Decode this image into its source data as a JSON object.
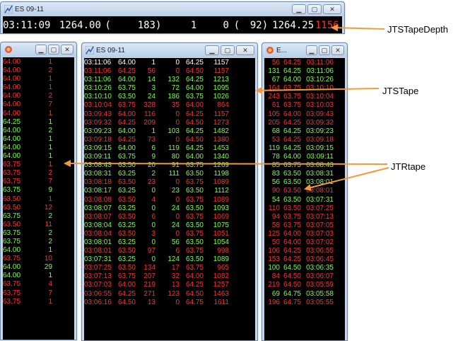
{
  "colors": {
    "up": "#80ff40",
    "down": "#ff3030",
    "neutral": "#ffffff",
    "background": "#000000",
    "arrow": "#f29a3a"
  },
  "depth_window": {
    "title": "ES 09-11",
    "time": "03:11:09",
    "price": "1264.00",
    "open_paren": "(",
    "bid_size": "183)",
    "ask_count": "1",
    "zero": "0",
    "open_paren2": "(",
    "ask_size": "92)",
    "last_price": "1264.25",
    "last_size": "1156"
  },
  "rtape_window": {
    "rows": [
      {
        "price": "64.00",
        "size": "1",
        "dir": "dn"
      },
      {
        "price": "64.00",
        "size": "2",
        "dir": "dn"
      },
      {
        "price": "64.00",
        "size": "1",
        "dir": "dn"
      },
      {
        "price": "64.00",
        "size": "1",
        "dir": "dn"
      },
      {
        "price": "64.00",
        "size": "2",
        "dir": "dn"
      },
      {
        "price": "64.00",
        "size": "7",
        "dir": "dn"
      },
      {
        "price": "64.00",
        "size": "1",
        "dir": "dn"
      },
      {
        "price": "64.25",
        "size": "1",
        "dir": "up"
      },
      {
        "price": "64.00",
        "size": "2",
        "dir": "up"
      },
      {
        "price": "64.00",
        "size": "1",
        "dir": "up"
      },
      {
        "price": "64.00",
        "size": "1",
        "dir": "up"
      },
      {
        "price": "64.00",
        "size": "1",
        "dir": "up"
      },
      {
        "price": "63.75",
        "size": "1",
        "dir": "dn"
      },
      {
        "price": "63.75",
        "size": "2",
        "dir": "dn"
      },
      {
        "price": "63.75",
        "size": "7",
        "dir": "dn"
      },
      {
        "price": "63.75",
        "size": "9",
        "dir": "up"
      },
      {
        "price": "63.50",
        "size": "1",
        "dir": "dn"
      },
      {
        "price": "63.50",
        "size": "12",
        "dir": "dn"
      },
      {
        "price": "63.75",
        "size": "2",
        "dir": "up"
      },
      {
        "price": "63.50",
        "size": "11",
        "dir": "dn"
      },
      {
        "price": "63.75",
        "size": "2",
        "dir": "up"
      },
      {
        "price": "63.75",
        "size": "2",
        "dir": "up"
      },
      {
        "price": "64.00",
        "size": "1",
        "dir": "up"
      },
      {
        "price": "63.75",
        "size": "10",
        "dir": "dn"
      },
      {
        "price": "64.00",
        "size": "29",
        "dir": "up"
      },
      {
        "price": "64.00",
        "size": "1",
        "dir": "up"
      },
      {
        "price": "63.75",
        "size": "4",
        "dir": "dn"
      },
      {
        "price": "63.75",
        "size": "7",
        "dir": "dn"
      },
      {
        "price": "63.75",
        "size": "1",
        "dir": "dn"
      }
    ]
  },
  "tape_window": {
    "title": "ES 09-11",
    "rows": [
      {
        "time": "03:11:06",
        "price": "64.00",
        "size": "1",
        "bid": "0",
        "ask": "64.25",
        "vol": "1157",
        "dir": "wt"
      },
      {
        "time": "03:11:06",
        "price": "64.25",
        "size": "56",
        "bid": "0",
        "ask": "64.50",
        "vol": "1157",
        "dir": "dn"
      },
      {
        "time": "03:11:06",
        "price": "64.00",
        "size": "14",
        "bid": "132",
        "ask": "64.25",
        "vol": "1213",
        "dir": "up"
      },
      {
        "time": "03:10:26",
        "price": "63.75",
        "size": "3",
        "bid": "72",
        "ask": "64.00",
        "vol": "1095",
        "dir": "up"
      },
      {
        "time": "03:10:10",
        "price": "63.50",
        "size": "24",
        "bid": "186",
        "ask": "63.75",
        "vol": "1026",
        "dir": "up"
      },
      {
        "time": "03:10:04",
        "price": "63.75",
        "size": "328",
        "bid": "35",
        "ask": "64.00",
        "vol": "864",
        "dir": "dn"
      },
      {
        "time": "03:09:43",
        "price": "64.00",
        "size": "116",
        "bid": "0",
        "ask": "64.25",
        "vol": "1157",
        "dir": "dn"
      },
      {
        "time": "03:09:32",
        "price": "64.25",
        "size": "209",
        "bid": "0",
        "ask": "64.50",
        "vol": "1273",
        "dir": "dn"
      },
      {
        "time": "03:09:23",
        "price": "64.00",
        "size": "1",
        "bid": "103",
        "ask": "64.25",
        "vol": "1482",
        "dir": "up"
      },
      {
        "time": "03:09:18",
        "price": "64.25",
        "size": "73",
        "bid": "0",
        "ask": "64.50",
        "vol": "1380",
        "dir": "dn"
      },
      {
        "time": "03:09:15",
        "price": "64.00",
        "size": "6",
        "bid": "119",
        "ask": "64.25",
        "vol": "1453",
        "dir": "up"
      },
      {
        "time": "03:09:11",
        "price": "63.75",
        "size": "9",
        "bid": "80",
        "ask": "64.00",
        "vol": "1340",
        "dir": "up"
      },
      {
        "time": "03:08:43",
        "price": "63.50",
        "size": "20",
        "bid": "91",
        "ask": "63.75",
        "vol": "1269",
        "dir": "up"
      },
      {
        "time": "03:08:31",
        "price": "63.25",
        "size": "2",
        "bid": "111",
        "ask": "63.50",
        "vol": "1198",
        "dir": "up"
      },
      {
        "time": "03:08:18",
        "price": "63.50",
        "size": "23",
        "bid": "0",
        "ask": "63.75",
        "vol": "1089",
        "dir": "dn"
      },
      {
        "time": "03:08:17",
        "price": "63.25",
        "size": "0",
        "bid": "23",
        "ask": "63.50",
        "vol": "1112",
        "dir": "up"
      },
      {
        "time": "03:08:08",
        "price": "63.50",
        "size": "4",
        "bid": "0",
        "ask": "63.75",
        "vol": "1089",
        "dir": "dn"
      },
      {
        "time": "03:08:07",
        "price": "63.25",
        "size": "0",
        "bid": "24",
        "ask": "63.50",
        "vol": "1093",
        "dir": "up"
      },
      {
        "time": "03:08:07",
        "price": "63.50",
        "size": "6",
        "bid": "0",
        "ask": "63.75",
        "vol": "1069",
        "dir": "dn"
      },
      {
        "time": "03:08:04",
        "price": "63.25",
        "size": "0",
        "bid": "24",
        "ask": "63.50",
        "vol": "1075",
        "dir": "up"
      },
      {
        "time": "03:08:04",
        "price": "63.50",
        "size": "3",
        "bid": "0",
        "ask": "63.75",
        "vol": "1051",
        "dir": "dn"
      },
      {
        "time": "03:08:01",
        "price": "63.25",
        "size": "0",
        "bid": "56",
        "ask": "63.50",
        "vol": "1054",
        "dir": "up"
      },
      {
        "time": "03:08:01",
        "price": "63.50",
        "size": "97",
        "bid": "6",
        "ask": "63.75",
        "vol": "998",
        "dir": "dn"
      },
      {
        "time": "03:07:31",
        "price": "63.25",
        "size": "0",
        "bid": "124",
        "ask": "63.50",
        "vol": "1089",
        "dir": "up"
      },
      {
        "time": "03:07:25",
        "price": "63.50",
        "size": "134",
        "bid": "17",
        "ask": "63.75",
        "vol": "965",
        "dir": "dn"
      },
      {
        "time": "03:07:13",
        "price": "63.75",
        "size": "207",
        "bid": "32",
        "ask": "64.00",
        "vol": "1082",
        "dir": "dn"
      },
      {
        "time": "03:07:03",
        "price": "64.00",
        "size": "219",
        "bid": "13",
        "ask": "64.25",
        "vol": "1257",
        "dir": "dn"
      },
      {
        "time": "03:06:55",
        "price": "64.25",
        "size": "271",
        "bid": "123",
        "ask": "64.50",
        "vol": "1463",
        "dir": "dn"
      },
      {
        "time": "03:06:16",
        "price": "64.50",
        "size": "13",
        "bid": "0",
        "ask": "64.75",
        "vol": "1611",
        "dir": "dn"
      }
    ]
  },
  "depth_small_window": {
    "title": "E...",
    "rows": [
      {
        "size": "56",
        "price": "64.25",
        "time": "03:11:06",
        "dir": "dn"
      },
      {
        "size": "131",
        "price": "64.25",
        "time": "03:11:06",
        "dir": "up"
      },
      {
        "size": "67",
        "price": "64.00",
        "time": "03:10:26",
        "dir": "up"
      },
      {
        "size": "164",
        "price": "63.75",
        "time": "03:10:10",
        "dir": "dn"
      },
      {
        "size": "243",
        "price": "63.75",
        "time": "03:10:04",
        "dir": "dn"
      },
      {
        "size": "61",
        "price": "63.75",
        "time": "03:10:03",
        "dir": "dn"
      },
      {
        "size": "105",
        "price": "64.00",
        "time": "03:09:43",
        "dir": "dn"
      },
      {
        "size": "205",
        "price": "64.25",
        "time": "03:09:32",
        "dir": "dn"
      },
      {
        "size": "68",
        "price": "64.25",
        "time": "03:09:23",
        "dir": "up"
      },
      {
        "size": "53",
        "price": "64.25",
        "time": "03:09:18",
        "dir": "dn"
      },
      {
        "size": "119",
        "price": "64.25",
        "time": "03:09:15",
        "dir": "up"
      },
      {
        "size": "78",
        "price": "64.00",
        "time": "03:09:11",
        "dir": "up"
      },
      {
        "size": "85",
        "price": "63.75",
        "time": "03:08:43",
        "dir": "up"
      },
      {
        "size": "83",
        "price": "63.50",
        "time": "03:08:31",
        "dir": "up"
      },
      {
        "size": "56",
        "price": "63.50",
        "time": "03:08:01",
        "dir": "up"
      },
      {
        "size": "90",
        "price": "63.50",
        "time": "03:08:01",
        "dir": "dn"
      },
      {
        "size": "54",
        "price": "63.50",
        "time": "03:07:31",
        "dir": "up"
      },
      {
        "size": "110",
        "price": "63.50",
        "time": "03:07:25",
        "dir": "dn"
      },
      {
        "size": "94",
        "price": "63.75",
        "time": "03:07:13",
        "dir": "dn"
      },
      {
        "size": "58",
        "price": "63.75",
        "time": "03:07:05",
        "dir": "dn"
      },
      {
        "size": "125",
        "price": "64.00",
        "time": "03:07:03",
        "dir": "dn"
      },
      {
        "size": "50",
        "price": "64.00",
        "time": "03:07:02",
        "dir": "dn"
      },
      {
        "size": "106",
        "price": "64.25",
        "time": "03:06:55",
        "dir": "dn"
      },
      {
        "size": "153",
        "price": "64.25",
        "time": "03:06:45",
        "dir": "dn"
      },
      {
        "size": "100",
        "price": "64.50",
        "time": "03:06:35",
        "dir": "up"
      },
      {
        "size": "84",
        "price": "64.50",
        "time": "03:06:07",
        "dir": "dn"
      },
      {
        "size": "219",
        "price": "64.50",
        "time": "03:05:59",
        "dir": "dn"
      },
      {
        "size": "69",
        "price": "64.75",
        "time": "03:05:58",
        "dir": "up"
      },
      {
        "size": "196",
        "price": "64.75",
        "time": "03:05:55",
        "dir": "dn"
      }
    ]
  },
  "callouts": {
    "tape_depth": "JTSTapeDepth",
    "tape": "JTSTape",
    "rtape": "JTRtape"
  }
}
